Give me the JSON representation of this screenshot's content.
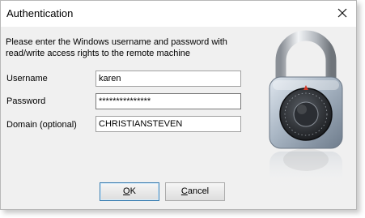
{
  "window": {
    "title": "Authentication"
  },
  "instructions": "Please enter the Windows username and password with read/write access rights to the remote machine",
  "form": {
    "username_label": "Username",
    "username_value": "karen",
    "password_label": "Password",
    "password_value": "***************",
    "domain_label": "Domain (optional)",
    "domain_value": "CHRISTIANSTEVEN"
  },
  "buttons": {
    "ok_label": "OK",
    "ok_mnemonic": "O",
    "cancel_label": "Cancel",
    "cancel_mnemonic": "C"
  },
  "icons": {
    "close": "close-icon",
    "lock": "padlock-icon"
  },
  "colors": {
    "window_bg": "#f0f0f0",
    "field_border": "#a0a0a0",
    "ok_border": "#3c7fb1"
  }
}
